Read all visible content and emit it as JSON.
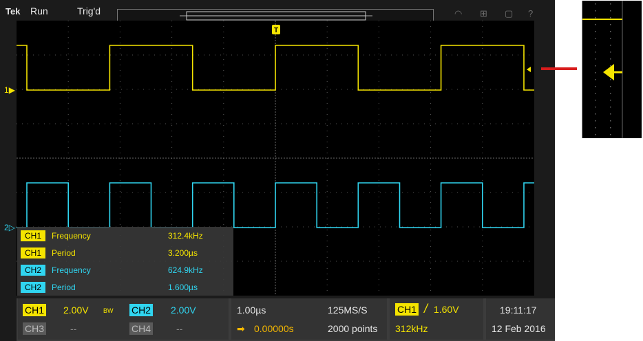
{
  "topbar": {
    "logo": "Tek",
    "run_state": "Run",
    "trigger_state": "Trig'd",
    "trigger_marker": "T",
    "icons": [
      "wifi-icon",
      "network-icon",
      "save-icon",
      "help-icon"
    ]
  },
  "channels": {
    "ch1_marker": "1",
    "ch2_marker": "2",
    "ch1_color": "#f5e400",
    "ch2_color": "#30d5f0",
    "ch1_period_us": 3.2,
    "ch2_period_us": 1.6
  },
  "measurements": [
    {
      "channel": "CH1",
      "name": "Frequency",
      "value": "312.4kHz",
      "color": "#f5e400"
    },
    {
      "channel": "CH1",
      "name": "Period",
      "value": "3.200µs",
      "color": "#f5e400"
    },
    {
      "channel": "CH2",
      "name": "Frequency",
      "value": "624.9kHz",
      "color": "#30d5f0"
    },
    {
      "channel": "CH2",
      "name": "Period",
      "value": "1.600µs",
      "color": "#30d5f0"
    }
  ],
  "bottom": {
    "ch1_label": "CH1",
    "ch1_scale": "2.00V",
    "bw_label": "BW",
    "ch2_label": "CH2",
    "ch2_scale": "2.00V",
    "ch3_label": "CH3",
    "ch3_scale": "--",
    "ch4_label": "CH4",
    "ch4_scale": "--",
    "timebase": "1.00µs",
    "sample_rate": "125MS/S",
    "position": "0.00000s",
    "record_length": "2000 points",
    "trigger_source": "CH1",
    "trigger_slope": "/",
    "trigger_level": "1.60V",
    "trigger_frequency": "312kHz",
    "time": "19:11:17",
    "date": "12 Feb 2016"
  }
}
